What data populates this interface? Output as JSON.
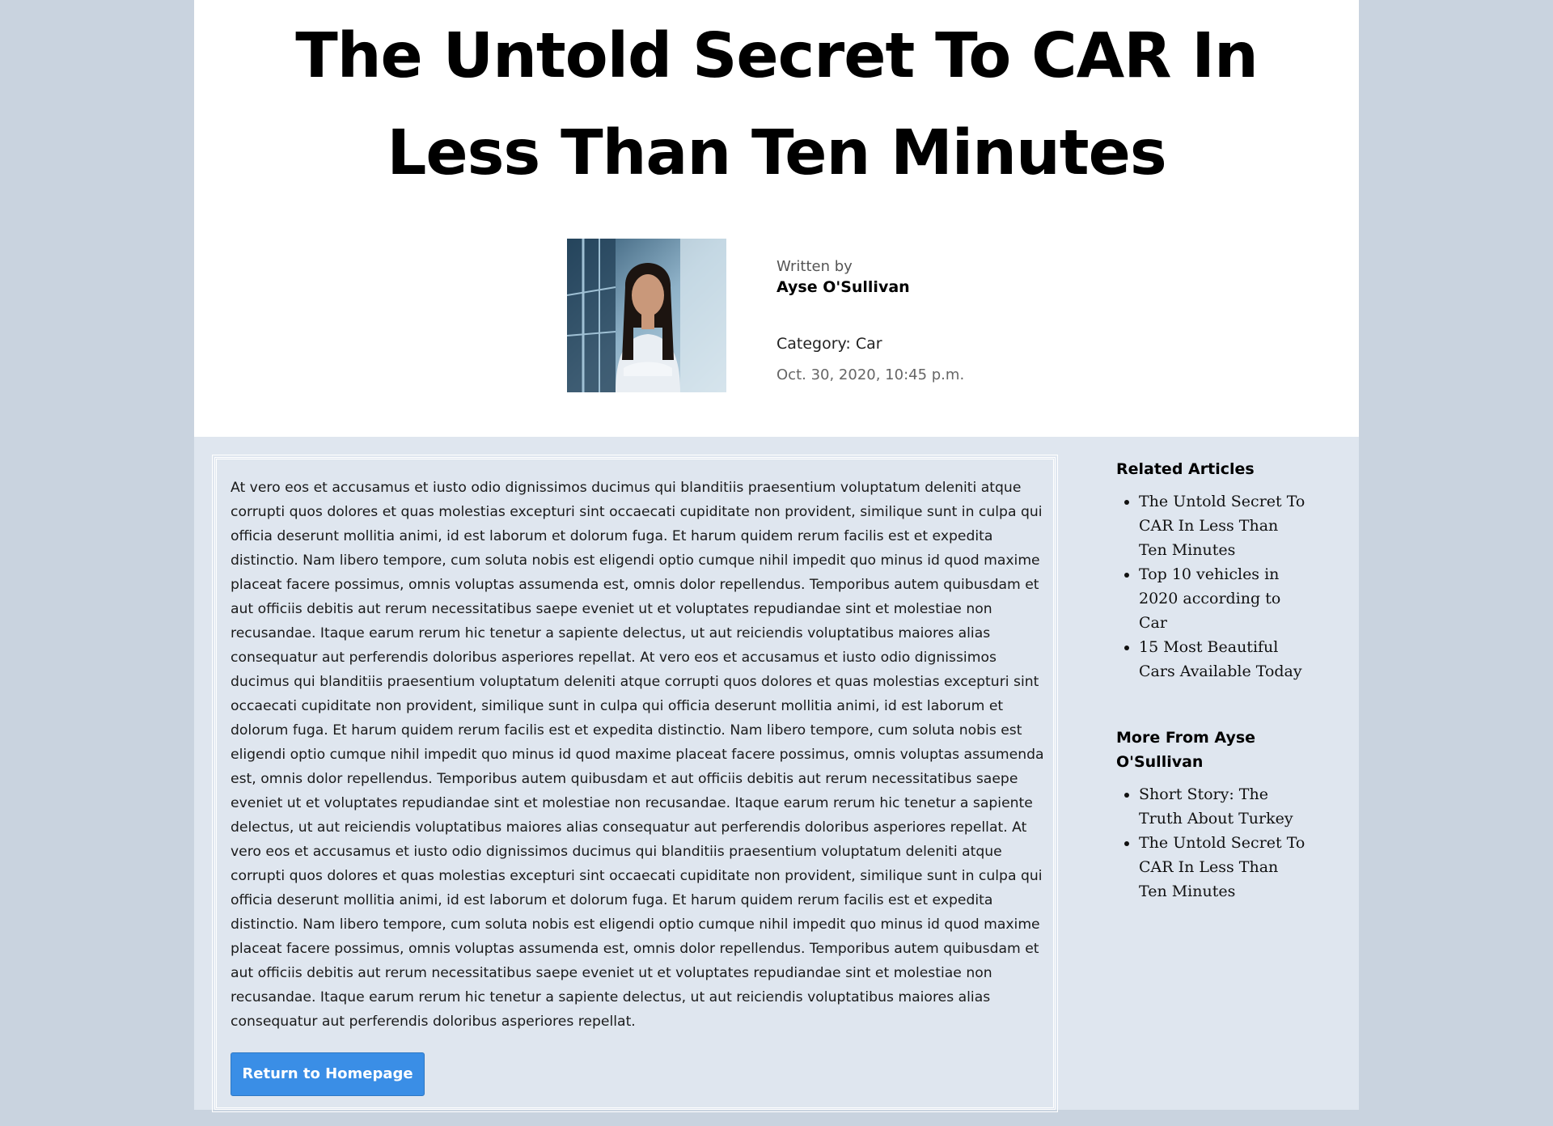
{
  "article": {
    "title": "The Untold Secret To CAR In Less Than Ten Minutes",
    "written_by_label": "Written by",
    "author": "Ayse O'Sullivan",
    "category": "Category: Car",
    "date": "Oct. 30, 2020, 10:45 p.m.",
    "body": "At vero eos et accusamus et iusto odio dignissimos ducimus qui blanditiis praesentium voluptatum deleniti atque corrupti quos dolores et quas molestias excepturi sint occaecati cupiditate non provident, similique sunt in culpa qui officia deserunt mollitia animi, id est laborum et dolorum fuga. Et harum quidem rerum facilis est et expedita distinctio. Nam libero tempore, cum soluta nobis est eligendi optio cumque nihil impedit quo minus id quod maxime placeat facere possimus, omnis voluptas assumenda est, omnis dolor repellendus. Temporibus autem quibusdam et aut officiis debitis aut rerum necessitatibus saepe eveniet ut et voluptates repudiandae sint et molestiae non recusandae. Itaque earum rerum hic tenetur a sapiente delectus, ut aut reiciendis voluptatibus maiores alias consequatur aut perferendis doloribus asperiores repellat. At vero eos et accusamus et iusto odio dignissimos ducimus qui blanditiis praesentium voluptatum deleniti atque corrupti quos dolores et quas molestias excepturi sint occaecati cupiditate non provident, similique sunt in culpa qui officia deserunt mollitia animi, id est laborum et dolorum fuga. Et harum quidem rerum facilis est et expedita distinctio. Nam libero tempore, cum soluta nobis est eligendi optio cumque nihil impedit quo minus id quod maxime placeat facere possimus, omnis voluptas assumenda est, omnis dolor repellendus. Temporibus autem quibusdam et aut officiis debitis aut rerum necessitatibus saepe eveniet ut et voluptates repudiandae sint et molestiae non recusandae. Itaque earum rerum hic tenetur a sapiente delectus, ut aut reiciendis voluptatibus maiores alias consequatur aut perferendis doloribus asperiores repellat. At vero eos et accusamus et iusto odio dignissimos ducimus qui blanditiis praesentium voluptatum deleniti atque corrupti quos dolores et quas molestias excepturi sint occaecati cupiditate non provident, similique sunt in culpa qui officia deserunt mollitia animi, id est laborum et dolorum fuga. Et harum quidem rerum facilis est et expedita distinctio. Nam libero tempore, cum soluta nobis est eligendi optio cumque nihil impedit quo minus id quod maxime placeat facere possimus, omnis voluptas assumenda est, omnis dolor repellendus. Temporibus autem quibusdam et aut officiis debitis aut rerum necessitatibus saepe eveniet ut et voluptates repudiandae sint et molestiae non recusandae. Itaque earum rerum hic tenetur a sapiente delectus, ut aut reiciendis voluptatibus maiores alias consequatur aut perferendis doloribus asperiores repellat.",
    "return_button_label": "Return to Homepage"
  },
  "sidebar": {
    "related_heading": "Related Articles",
    "related": [
      "The Untold Secret To CAR In Less Than Ten Minutes",
      "Top 10 vehicles in 2020 according to Car",
      "15 Most Beautiful Cars Available Today"
    ],
    "more_heading": "More From Ayse O'Sullivan",
    "more": [
      "Short Story: The Truth About Turkey",
      "The Untold Secret To CAR In Less Than Ten Minutes"
    ]
  },
  "colors": {
    "page_background": "#c9d3df",
    "content_background": "#dfe6ef",
    "header_background": "#ffffff",
    "button_background": "#3a8ee6"
  },
  "icons": {
    "author_photo": "portrait-photo"
  }
}
